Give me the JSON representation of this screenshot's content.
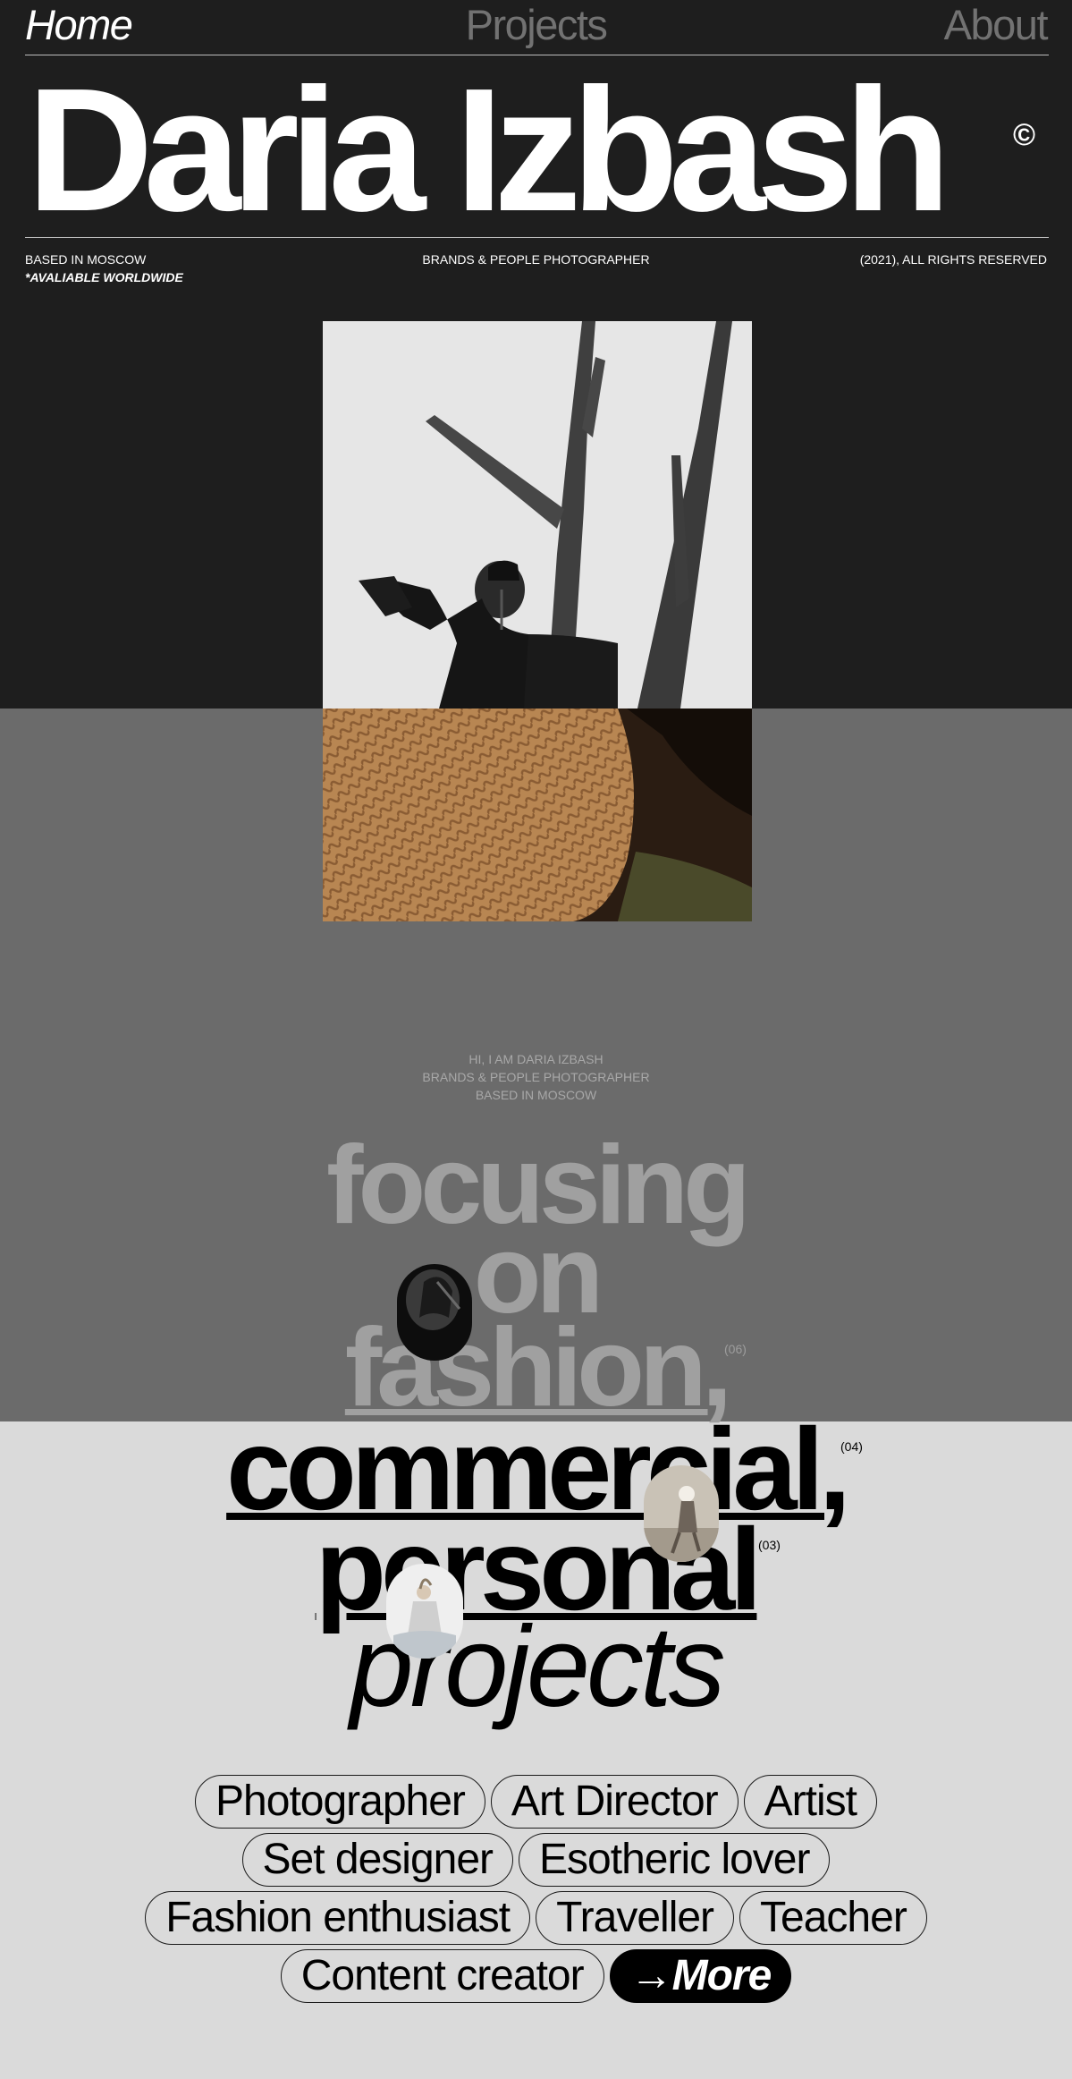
{
  "nav": {
    "home": "Home",
    "projects": "Projects",
    "about": "About"
  },
  "hero": {
    "title": "Daria Izbash",
    "copyright_symbol": "©",
    "location": "BASED IN MOSCOW",
    "availability": "*AVALIABLE WORLDWIDE",
    "role": "BRANDS & PEOPLE PHOTOGRAPHER",
    "rights": "(2021), ALL RIGHTS RESERVED"
  },
  "intro": {
    "line1": "HI, I AM DARIA IZBASH",
    "line2": "BRANDS & PEOPLE PHOTOGRAPHER",
    "line3": "BASED IN MOSCOW"
  },
  "statement": {
    "w1": "focusing",
    "w2": "on",
    "w3": "fashion,",
    "w3_count": "(06)",
    "w4": "commercial,",
    "w4_count": "(04)",
    "w5": "personal",
    "w5_count": "(03)",
    "w6": "projects"
  },
  "tags": {
    "row1": [
      "Photographer",
      "Art Director",
      "Artist"
    ],
    "row2": [
      "Set designer",
      "Esotheric lover"
    ],
    "row3": [
      "Fashion enthusiast",
      "Traveller",
      "Teacher"
    ],
    "row4": [
      "Content creator"
    ],
    "more": "→More"
  },
  "colors": {
    "dark_bg": "#1e1e1e",
    "mid_bg": "#6b6b6b",
    "light_bg": "#dadada"
  }
}
